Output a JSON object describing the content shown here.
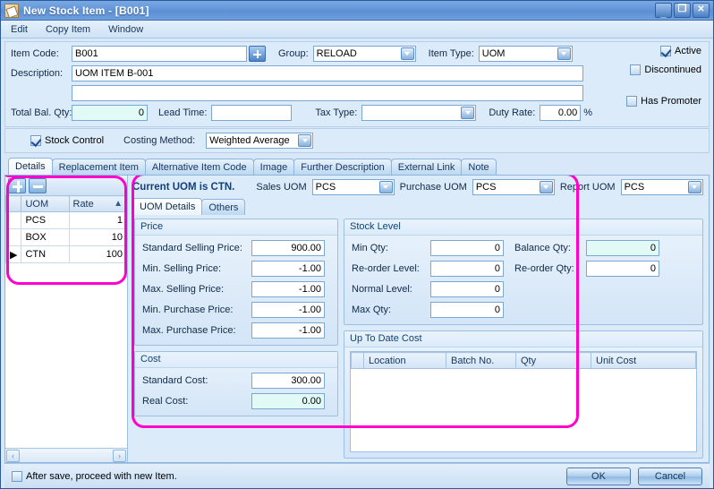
{
  "window": {
    "title": "New Stock Item - [B001]",
    "icon": "document-icon",
    "controls": {
      "minimize": "_",
      "maximize": "❐",
      "close": "✕"
    }
  },
  "menu": {
    "items": [
      "Edit",
      "Copy Item",
      "Window"
    ]
  },
  "header": {
    "item_code": {
      "label": "Item Code:",
      "value": "B001"
    },
    "group": {
      "label": "Group:",
      "value": "RELOAD"
    },
    "item_type": {
      "label": "Item Type:",
      "value": "UOM"
    },
    "description": {
      "label": "Description:",
      "value": "UOM ITEM B-001",
      "value2": ""
    },
    "total_bal_qty": {
      "label": "Total Bal. Qty:",
      "value": "0"
    },
    "lead_time": {
      "label": "Lead Time:",
      "value": ""
    },
    "tax_type": {
      "label": "Tax Type:",
      "value": ""
    },
    "duty_rate": {
      "label": "Duty Rate:",
      "value": "0.00",
      "suffix": "%"
    },
    "active": {
      "label": "Active",
      "checked": true
    },
    "discontinued": {
      "label": "Discontinued",
      "checked": false
    },
    "has_promoter": {
      "label": "Has Promoter",
      "checked": false
    },
    "stock_control": {
      "label": "Stock Control",
      "checked": true
    },
    "costing_method": {
      "label": "Costing Method:",
      "value": "Weighted Average"
    }
  },
  "tabs": {
    "items": [
      "Details",
      "Replacement Item",
      "Alternative Item Code",
      "Image",
      "Further Description",
      "External Link",
      "Note"
    ],
    "active": "Details"
  },
  "uom_grid": {
    "add_button": "add-row-button",
    "remove_button": "remove-row-button",
    "columns": [
      "UOM",
      "Rate"
    ],
    "sort_indicator": "▲",
    "rows": [
      {
        "marker": "",
        "uom": "PCS",
        "rate": "1",
        "selected": false
      },
      {
        "marker": "",
        "uom": "BOX",
        "rate": "10",
        "selected": false
      },
      {
        "marker": "▶",
        "uom": "CTN",
        "rate": "100",
        "selected": true
      }
    ]
  },
  "uom_panel": {
    "current_uom_text": "Current UOM is CTN.",
    "sales_uom": {
      "label": "Sales UOM",
      "value": "PCS"
    },
    "purchase_uom": {
      "label": "Purchase UOM",
      "value": "PCS"
    },
    "report_uom": {
      "label": "Report UOM",
      "value": "PCS"
    },
    "subtabs": {
      "items": [
        "UOM Details",
        "Others"
      ],
      "active": "UOM Details"
    }
  },
  "price_panel": {
    "title": "Price",
    "fields": [
      {
        "label": "Standard Selling Price:",
        "value": "900.00",
        "readonly": false
      },
      {
        "label": "Min. Selling Price:",
        "value": "-1.00",
        "readonly": false
      },
      {
        "label": "Max. Selling Price:",
        "value": "-1.00",
        "readonly": false
      },
      {
        "label": "Min. Purchase Price:",
        "value": "-1.00",
        "readonly": false
      },
      {
        "label": "Max. Purchase Price:",
        "value": "-1.00",
        "readonly": false
      }
    ]
  },
  "cost_panel": {
    "title": "Cost",
    "fields": [
      {
        "label": "Standard Cost:",
        "value": "300.00",
        "readonly": false
      },
      {
        "label": "Real Cost:",
        "value": "0.00",
        "readonly": true
      }
    ]
  },
  "stock_level_panel": {
    "title": "Stock Level",
    "left_fields": [
      {
        "label": "Min Qty:",
        "value": "0",
        "readonly": false
      },
      {
        "label": "Re-order Level:",
        "value": "0",
        "readonly": false
      },
      {
        "label": "Normal Level:",
        "value": "0",
        "readonly": false
      },
      {
        "label": "Max Qty:",
        "value": "0",
        "readonly": false
      }
    ],
    "right_fields": [
      {
        "label": "Balance Qty:",
        "value": "0",
        "readonly": true
      },
      {
        "label": "Re-order Qty:",
        "value": "0",
        "readonly": false
      }
    ]
  },
  "up_to_date_cost": {
    "title": "Up To Date Cost",
    "columns": [
      "Location",
      "Batch No.",
      "Qty",
      "Unit Cost"
    ],
    "rows": []
  },
  "footer": {
    "proceed_checkbox": {
      "label": "After save, proceed with new Item.",
      "checked": false
    },
    "ok_label": "OK",
    "cancel_label": "Cancel"
  },
  "colors": {
    "annotation": "#ff00cc",
    "titlebar": "#6394d8",
    "readonly_field": "#e2faf6",
    "selected_row": "#7c9ccb"
  }
}
